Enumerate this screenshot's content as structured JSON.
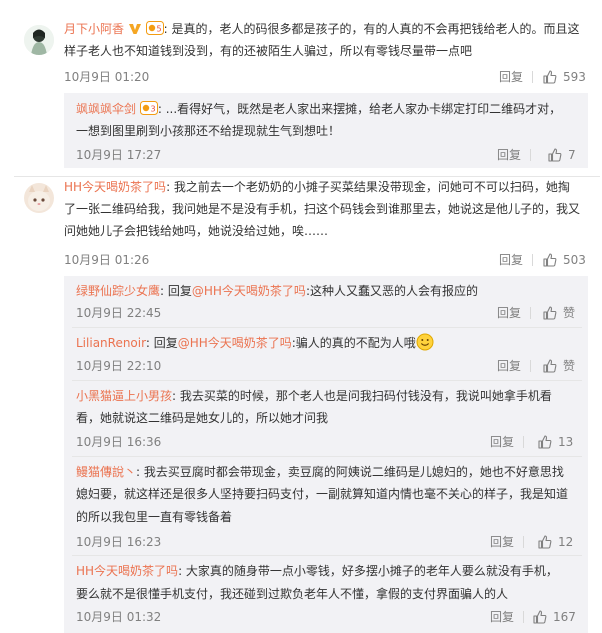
{
  "icons": {
    "like": "thumbs-up-icon",
    "verified": "v-badge-icon",
    "vip": "vip-badge-icon",
    "smile_emoji": "smile-emoji-icon"
  },
  "colors": {
    "username": "#eb7350",
    "text": "#333333",
    "meta": "#808080",
    "reply_bg": "#f2f2f5"
  },
  "comments": [
    {
      "user": "月下小阿香",
      "lines": [
        ": 是真的，老人的码很多都是孩子的，有的人真的不会再把钱给老人的。而且这",
        "样子老人也不知道钱到没到，有的还被陌生人骗过，所以有零钱尽量带一点吧"
      ],
      "time": "10月9日 01:20",
      "reply_label": "回复",
      "likes": "593"
    },
    {
      "user": "HH今天喝奶茶了吗",
      "lines": [
        ": 我之前去一个老奶奶的小摊子买菜结果没带现金，问她可不可以扫码，她掏",
        "了一张二维码给我，我问她是不是没有手机，扫这个码钱会到谁那里去，她说这是他儿子的，我又",
        "问她她儿子会把钱给她吗，她说没给过她，唉……"
      ],
      "time": "10月9日 01:26",
      "reply_label": "回复",
      "likes": "503"
    }
  ],
  "replies_a": [
    {
      "user": "飒飒飒伞剑",
      "lines": [
        ": ...看得好气，既然是老人家出来摆摊，给老人家办卡绑定打印二维码才对，",
        "一想到图里刷到小孩那还不给提现就生气到想吐！"
      ],
      "time": "10月9日 17:27",
      "reply_label": "回复",
      "likes": "7"
    }
  ],
  "replies_b": [
    {
      "user": "绿野仙踪少女鹰",
      "reply_prefix": ": 回复",
      "mention": "@HH今天喝奶茶了吗",
      "text": ":这种人又蠢又恶的人会有报应的",
      "time": "10月9日 22:45",
      "reply_label": "回复",
      "likes": "赞"
    },
    {
      "user": "LilianRenoir",
      "reply_prefix": ": 回复",
      "mention": "@HH今天喝奶茶了吗",
      "text": ":骗人的真的不配为人哦",
      "time": "10月9日 22:10",
      "reply_label": "回复",
      "likes": "赞"
    },
    {
      "user": "小黑猫逼上小男孩",
      "lines": [
        ": 我去买菜的时候，那个老人也是问我扫码付钱没有，我说叫她拿手机看",
        "看，她就说这二维码是她女儿的，所以她才问我"
      ],
      "time": "10月9日 16:36",
      "reply_label": "回复",
      "likes": "13"
    },
    {
      "user": "鳗猫傳說丶",
      "lines": [
        ": 我去买豆腐时都会带现金，卖豆腐的阿姨说二维码是儿媳妇的，她也不好意思找",
        "媳妇要，就这样还是很多人坚持要扫码支付，一副就算知道内情也毫不关心的样子，我是知道",
        "的所以我包里一直有零钱备着"
      ],
      "time": "10月9日 16:23",
      "reply_label": "回复",
      "likes": "12"
    },
    {
      "user": "HH今天喝奶茶了吗",
      "lines": [
        ": 大家真的随身带一点小零钱，好多摆小摊子的老年人要么就没有手机，",
        "要么就不是很懂手机支付，我还碰到过欺负老年人不懂，拿假的支付界面骗人的人"
      ],
      "time": "10月9日 01:32",
      "reply_label": "回复",
      "likes": "167"
    }
  ]
}
